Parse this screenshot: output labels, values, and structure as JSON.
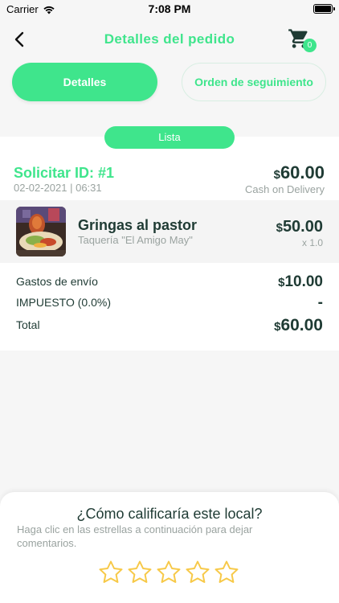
{
  "status_bar": {
    "carrier": "Carrier",
    "time": "7:08 PM"
  },
  "nav": {
    "title": "Detalles del pedido",
    "cart_count": "0"
  },
  "tabs": [
    {
      "label": "Detalles",
      "active": true
    },
    {
      "label": "Orden de seguimiento",
      "active": false
    }
  ],
  "order": {
    "status": "Lista",
    "id_label": "Solicitar ID: #1",
    "date": "02-02-2021 | 06:31",
    "currency": "$",
    "total": "60.00",
    "payment_method": "Cash on Delivery"
  },
  "item": {
    "name": "Gringas al pastor",
    "store": "Taquería \"El Amigo May\"",
    "price": "50.00",
    "qty": "x 1.0"
  },
  "summary": {
    "shipping_label": "Gastos de envío",
    "shipping_value": "10.00",
    "tax_label": "IMPUESTO (0.0%)",
    "tax_value": "-",
    "total_label": "Total",
    "total_value": "60.00"
  },
  "rating": {
    "title": "¿Cómo calificaría este local?",
    "subtitle": "Haga clic en las estrellas a continuación para dejar comentarios.",
    "stars": 5,
    "selected": 0
  },
  "colors": {
    "accent": "#3fe58c",
    "text_dark": "#1f3b34",
    "text_muted": "#9aa3a0",
    "star": "#f7c948"
  }
}
